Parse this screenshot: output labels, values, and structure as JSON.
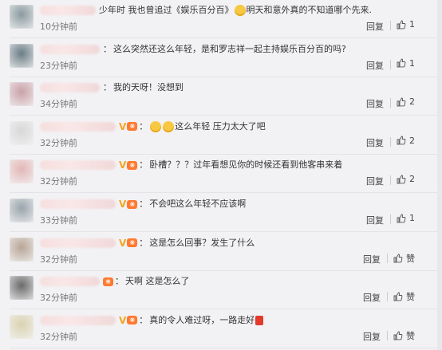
{
  "comments": [
    {
      "prefix": "少年时 我也曾追过《娱乐百分百》",
      "emoji_after_prefix": true,
      "text": "明天和意外真的不知道哪个先来.",
      "badges": false,
      "emojis_before_text": 0,
      "candle": false,
      "time": "10分钟前",
      "reply": "回复",
      "like": "1",
      "avatar_color": "#8a9aa0"
    },
    {
      "prefix": "",
      "emoji_after_prefix": false,
      "text": "这么突然还这么年轻，是和罗志祥一起主持娱乐百分百的吗?",
      "badges": false,
      "emojis_before_text": 0,
      "candle": false,
      "time": "23分钟前",
      "reply": "回复",
      "like": "1",
      "avatar_color": "#6b7d86"
    },
    {
      "prefix": "",
      "emoji_after_prefix": false,
      "text": "我的天呀！没想到",
      "badges": false,
      "emojis_before_text": 0,
      "candle": false,
      "time": "34分钟前",
      "reply": "回复",
      "like": "2",
      "avatar_color": "#c9a1a8"
    },
    {
      "prefix": "",
      "emoji_after_prefix": false,
      "text": "这么年轻  压力太大了吧",
      "badges": true,
      "emojis_before_text": 2,
      "candle": false,
      "time": "32分钟前",
      "reply": "回复",
      "like": "2",
      "avatar_color": "#d8d8d8"
    },
    {
      "prefix": "",
      "emoji_after_prefix": false,
      "text": "卧槽？？？过年看想见你的时候还看到他客串来着",
      "badges": true,
      "emojis_before_text": 0,
      "candle": false,
      "time": "32分钟前",
      "reply": "回复",
      "like": "2",
      "avatar_color": "#e3b7b7"
    },
    {
      "prefix": "",
      "emoji_after_prefix": false,
      "text": "不会吧这么年轻不应该啊",
      "badges": true,
      "emojis_before_text": 0,
      "candle": false,
      "time": "33分钟前",
      "reply": "回复",
      "like": "1",
      "avatar_color": "#9aa4ad"
    },
    {
      "prefix": "",
      "emoji_after_prefix": false,
      "text": "这是怎么回事？发生了什么",
      "badges": true,
      "emojis_before_text": 0,
      "candle": false,
      "time": "32分钟前",
      "reply": "回复",
      "like": "赞",
      "avatar_color": "#b8a597"
    },
    {
      "prefix": "",
      "emoji_after_prefix": false,
      "text": "天啊 这是怎么了",
      "badges": false,
      "lv_only": true,
      "emojis_before_text": 0,
      "candle": false,
      "time": "32分钟前",
      "reply": "回复",
      "like": "赞",
      "avatar_color": "#6a6a6a"
    },
    {
      "prefix": "",
      "emoji_after_prefix": false,
      "text": "真的令人难过呀，一路走好",
      "badges": true,
      "emojis_before_text": 0,
      "candle": true,
      "time": "32分钟前",
      "reply": "回复",
      "like": "赞",
      "avatar_color": "#d9d2b0"
    }
  ],
  "colors": {
    "lv_badge": "#ff7a2f",
    "v_badge": "#f5a623",
    "background": "#f2f2f5"
  }
}
